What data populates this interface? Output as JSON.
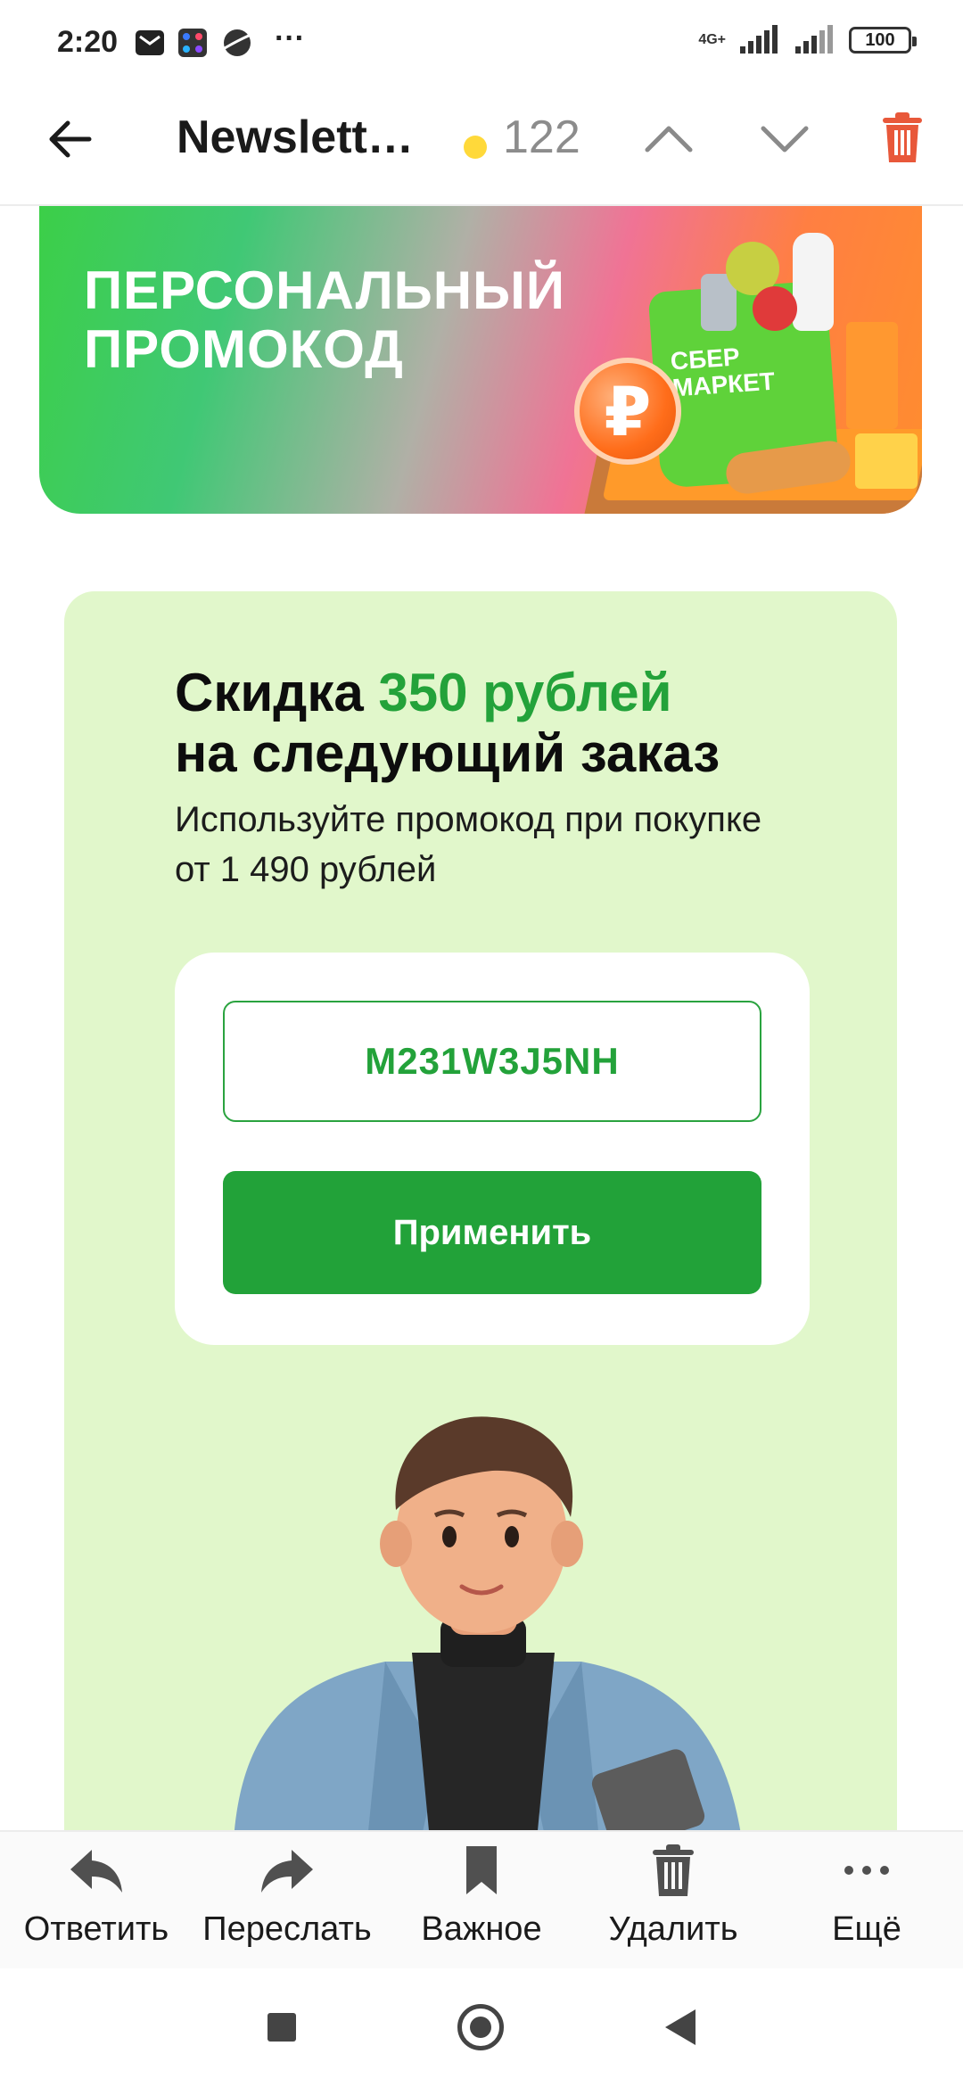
{
  "status_bar": {
    "time": "2:20",
    "more": "···",
    "network": "4G+",
    "battery": "100"
  },
  "header": {
    "title": "Newslett…",
    "unread_count": "122"
  },
  "banner": {
    "title_line1": "ПЕРСОНАЛЬНЫЙ",
    "title_line2": "ПРОМОКОД",
    "brand_line1": "СБЕР",
    "brand_line2": "МАРКЕТ",
    "coin_symbol": "₽"
  },
  "promo": {
    "headline_prefix": "Скидка ",
    "headline_amount": "350 рублей",
    "headline_line2": "на следующий заказ",
    "subtext": "Используйте промокод при покупке от 1 490 рублей",
    "code": "M231W3J5NH",
    "apply_label": "Применить"
  },
  "actions": [
    {
      "label": "Ответить",
      "icon": "reply-icon"
    },
    {
      "label": "Переслать",
      "icon": "forward-icon"
    },
    {
      "label": "Важное",
      "icon": "bookmark-icon"
    },
    {
      "label": "Удалить",
      "icon": "trash-icon"
    },
    {
      "label": "Ещё",
      "icon": "more-icon"
    }
  ],
  "colors": {
    "accent_green": "#23a23a",
    "delete_red": "#e8583a",
    "promo_bg": "#e1f7cb"
  }
}
